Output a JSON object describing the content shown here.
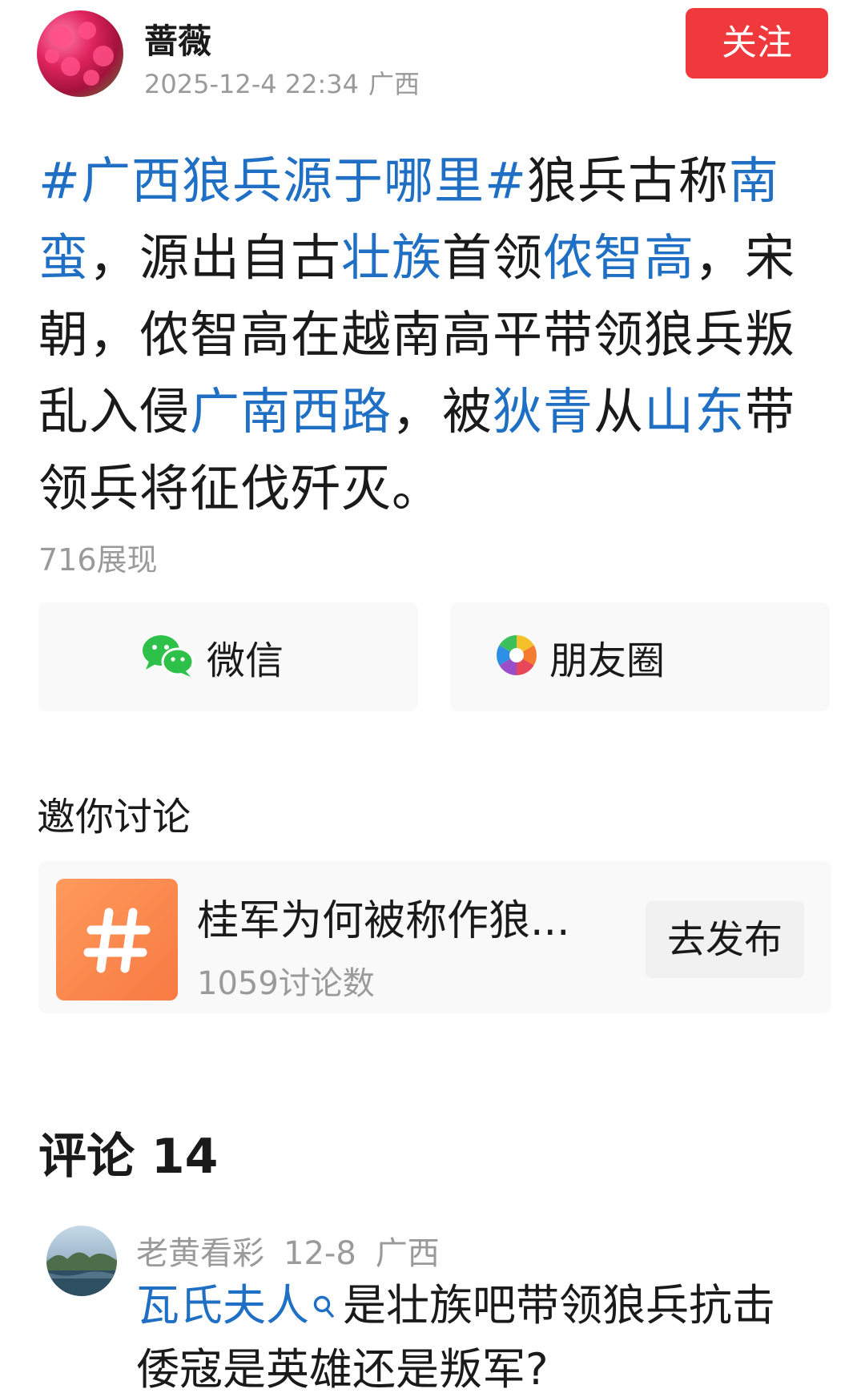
{
  "author": {
    "name": "蔷薇",
    "date": "2025-12-4 22:34",
    "location": "广西",
    "follow_label": "关注"
  },
  "post": {
    "segments": [
      {
        "text": "#广西狼兵源于哪里#",
        "link": true
      },
      {
        "text": "狼兵古称",
        "link": false
      },
      {
        "text": "南蛮",
        "link": true
      },
      {
        "text": "，源出自古",
        "link": false
      },
      {
        "text": "壮族",
        "link": true
      },
      {
        "text": "首领",
        "link": false
      },
      {
        "text": "侬智高",
        "link": true
      },
      {
        "text": "，宋朝，侬智高在越南高平带领狼兵叛乱入侵",
        "link": false
      },
      {
        "text": "广南西路",
        "link": true
      },
      {
        "text": "，被",
        "link": false
      },
      {
        "text": "狄青",
        "link": true
      },
      {
        "text": "从",
        "link": false
      },
      {
        "text": "山东",
        "link": true
      },
      {
        "text": "带领兵将征伐歼灭。",
        "link": false
      }
    ],
    "views": "716展现"
  },
  "share": {
    "wechat_label": "微信",
    "moments_label": "朋友圈"
  },
  "discussion": {
    "section_title": "邀你讨论",
    "topic_title": "桂军为何被称作狼...",
    "topic_count": "1059讨论数",
    "publish_label": "去发布"
  },
  "comments": {
    "heading": "评论 14",
    "items": [
      {
        "user": "老黄看彩",
        "date": "12-8",
        "location": "广西",
        "mention": "瓦氏夫人",
        "text": "是壮族吧带领狼兵抗击倭寇是英雄还是叛军?"
      }
    ]
  },
  "colors": {
    "link": "#1f6fc4",
    "follow": "#f0393c",
    "topic_icon": "#f7864b",
    "meta": "#9a9a9a"
  },
  "icons": [
    "wechat-icon",
    "moments-icon",
    "hashtag-icon",
    "search-icon"
  ]
}
